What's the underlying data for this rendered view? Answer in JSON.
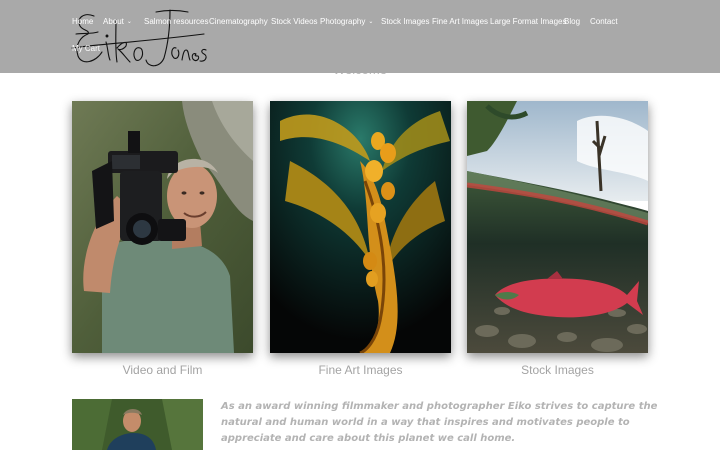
{
  "brand": {
    "logo_text": "Eiko Jones"
  },
  "nav": {
    "items": [
      {
        "label": "Home",
        "has_dropdown": false
      },
      {
        "label": "About",
        "has_dropdown": true
      },
      {
        "label": "Salmon resources",
        "has_dropdown": false
      },
      {
        "label": "Cinematography",
        "has_dropdown": false
      },
      {
        "label": "Stock Videos",
        "has_dropdown": false
      },
      {
        "label": "Photography",
        "has_dropdown": true
      },
      {
        "label": "Stock Images",
        "has_dropdown": false
      },
      {
        "label": "Fine Art Images",
        "has_dropdown": false
      },
      {
        "label": "Large Format Images",
        "has_dropdown": false
      },
      {
        "label": "Blog",
        "has_dropdown": false
      },
      {
        "label": "Contact",
        "has_dropdown": false
      },
      {
        "label": "My Cart",
        "has_dropdown": false
      }
    ],
    "caret_glyph": "⌄"
  },
  "welcome": "Welcome",
  "cards": [
    {
      "label": "Video and Film",
      "image": "photographer-with-camera"
    },
    {
      "label": "Fine Art Images",
      "image": "kelp-underwater"
    },
    {
      "label": "Stock Images",
      "image": "salmon-split-view"
    }
  ],
  "mission": {
    "lines": [
      "As an award winning filmmaker and photographer Eiko strives to capture the",
      "natural and human world in a way that inspires and motivates people to",
      "appreciate and care about this planet we call home."
    ]
  },
  "colors": {
    "header_bg": "#a9a9a9",
    "nav_text": "#ffffff",
    "label_text": "#a3a3a3",
    "mission_text": "#b3b3b3"
  }
}
